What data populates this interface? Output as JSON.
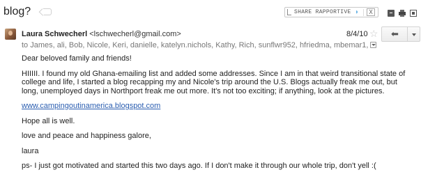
{
  "subject": "blog?",
  "rapportive": {
    "label": "SHARE RAPPORTIVE",
    "close": "X"
  },
  "message": {
    "sender_name": "Laura Schwecherl",
    "sender_email": "<lschwecherl@gmail.com>",
    "recipients": "to James, ali, Bob, Nicole, Keri, danielle, katelyn.nichols, Kathy, Rich, sunflwr952, hfriedma, mbemar1,",
    "date": "8/4/10",
    "star": "☆",
    "reply_glyph": "⬅"
  },
  "body": {
    "greeting": "Dear beloved family and friends!",
    "paragraph1": "HIIIII.  I found my old Ghana-emailing list and added some addresses.  Since I am in that weird transitional state of college and life, I started a blog recapping my and Nicole's trip around the U.S.  Blogs actually freak me out, but long, unemployed days in Northport freak me out more.  It's not too exciting; if anything, look at the pictures.",
    "link": "www.campingoutinamerica.blogspot.com",
    "hope": "Hope all is well.",
    "closing": "love and peace and happiness galore,",
    "signature": "laura",
    "ps": "ps- I just got motivated and started this two days ago.  If I don't make it through our whole trip, don't yell :("
  },
  "colors": {
    "link": "#2a5db0",
    "muted": "#777777",
    "text": "#222222"
  }
}
